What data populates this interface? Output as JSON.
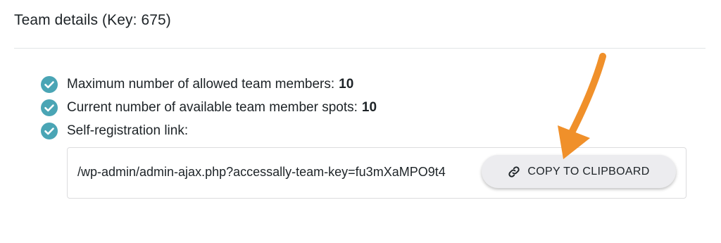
{
  "section": {
    "title": "Team details (Key: 675)"
  },
  "info": {
    "items": [
      {
        "label": "Maximum number of allowed team members:",
        "value": "10"
      },
      {
        "label": "Current number of available team member spots:",
        "value": "10"
      },
      {
        "label": "Self-registration link:",
        "value": ""
      }
    ]
  },
  "registration_link": {
    "url": "/wp-admin/admin-ajax.php?accessally-team-key=fu3mXaMPO9t4",
    "copy_button_label": "COPY TO CLIPBOARD",
    "copy_icon": "link-icon"
  },
  "colors": {
    "check_teal": "#4aa5b5",
    "annotation_arrow": "#f0902a"
  }
}
